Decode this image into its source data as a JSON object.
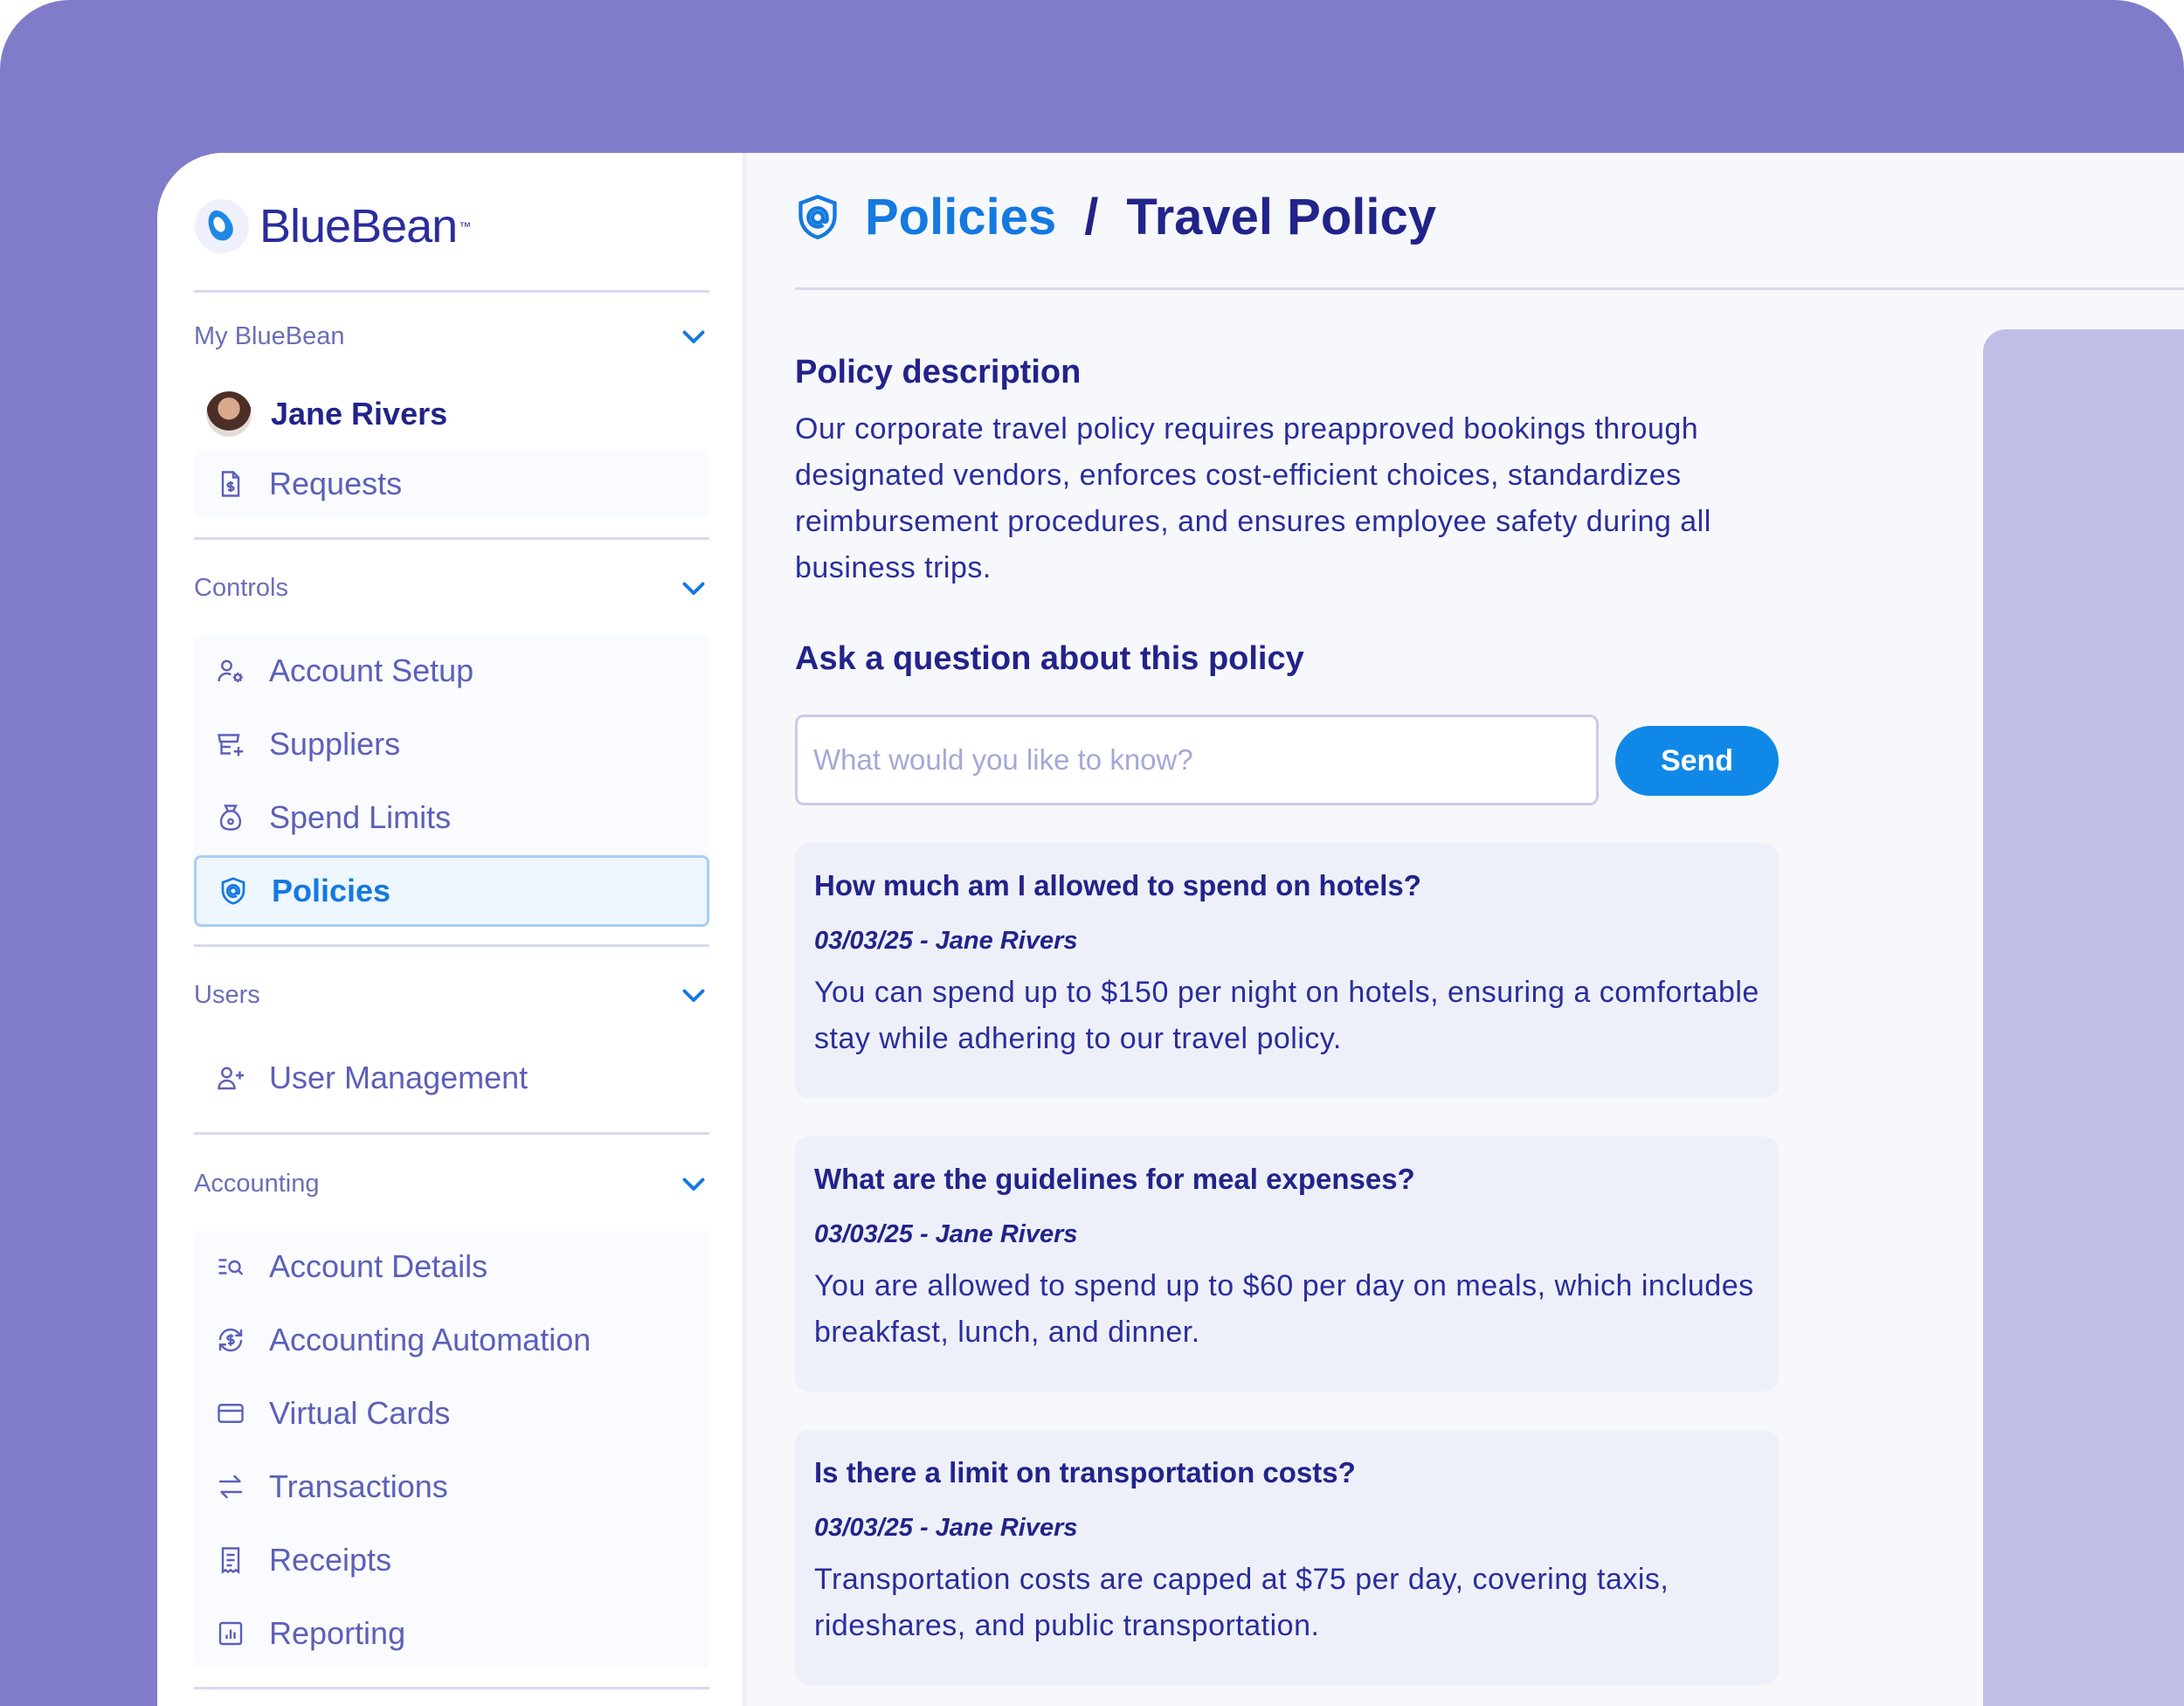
{
  "app": {
    "brand": "BlueBean",
    "brand_tm": "™"
  },
  "sidebar": {
    "sections": [
      {
        "title": "My BlueBean"
      },
      {
        "title": "Controls"
      },
      {
        "title": "Users"
      },
      {
        "title": "Accounting"
      }
    ],
    "user_name": "Jane Rivers",
    "items": {
      "requests": "Requests",
      "account_setup": "Account Setup",
      "suppliers": "Suppliers",
      "spend_limits": "Spend Limits",
      "policies": "Policies",
      "user_management": "User Management",
      "account_details": "Account Details",
      "accounting_automation": "Accounting Automation",
      "virtual_cards": "Virtual Cards",
      "transactions": "Transactions",
      "receipts": "Receipts",
      "reporting": "Reporting"
    },
    "active_item": "policies"
  },
  "main": {
    "breadcrumb": {
      "parent": "Policies",
      "separator": "/",
      "current": "Travel Policy"
    },
    "description_title": "Policy description",
    "description": "Our corporate travel policy requires preapproved bookings through designated vendors, enforces cost-efficient choices, standardizes reimbursement procedures, and ensures employee safety during all business trips.",
    "ask_title": "Ask a question about this policy",
    "ask_placeholder": "What would you like to know?",
    "ask_value": "",
    "send_label": "Send",
    "qa": [
      {
        "question": "How much am I allowed to spend on hotels?",
        "meta": "03/03/25 - Jane Rivers",
        "answer": "You can spend up to $150 per night on hotels, ensuring a comfortable stay while adhering to our travel policy."
      },
      {
        "question": "What are the guidelines for meal expenses?",
        "meta": "03/03/25 - Jane Rivers",
        "answer": "You are allowed to spend up to $60 per day on meals, which includes breakfast, lunch, and dinner."
      },
      {
        "question": "Is there a limit on transportation costs?",
        "meta": "03/03/25 - Jane Rivers",
        "answer": "Transportation costs are capped at $75 per day, covering taxis, rideshares, and public transportation."
      }
    ]
  },
  "icons": {
    "logo": "bluebean-logo-icon",
    "section_toggle": "chevron-down-icon",
    "requests": "invoice-dollar-icon",
    "account_setup": "user-gear-icon",
    "suppliers": "store-plus-icon",
    "spend_limits": "money-bag-icon",
    "policies": "shield-at-icon",
    "user_management": "user-plus-icon",
    "account_details": "list-search-icon",
    "accounting_automation": "dollar-cycle-icon",
    "virtual_cards": "credit-card-icon",
    "transactions": "arrows-exchange-icon",
    "receipts": "receipt-icon",
    "reporting": "chart-report-icon"
  },
  "colors": {
    "backdrop": "#807cca",
    "brand_navy": "#22238a",
    "accent_blue": "#1479e0",
    "send_button": "#1088e8",
    "muted_purple": "#5c60b8",
    "doc_preview": "#c0bde6"
  }
}
